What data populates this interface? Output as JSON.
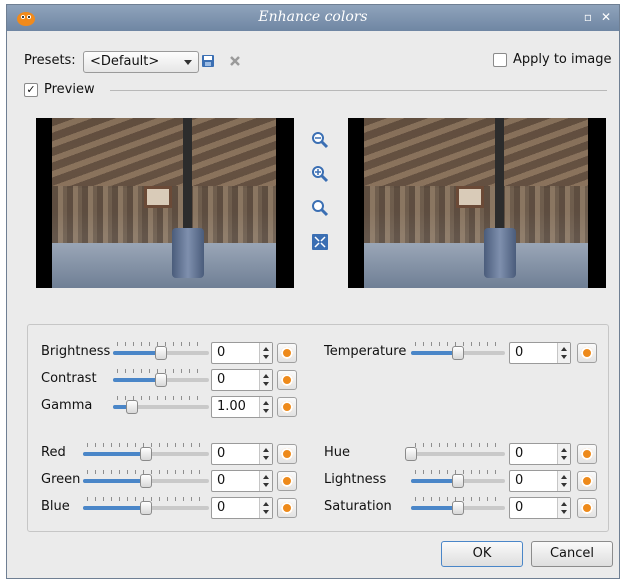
{
  "window": {
    "title": "Enhance colors"
  },
  "presets": {
    "label": "Presets:",
    "selected": "<Default>"
  },
  "apply_to_image": {
    "label": "Apply to image",
    "checked": false
  },
  "preview": {
    "label": "Preview",
    "checked": true,
    "checkmark": "✓"
  },
  "icons": {
    "app": "gimp-wilber-icon",
    "save_preset": "floppy-disk-icon",
    "delete_preset": "delete-icon",
    "zoom_out": "zoom-out-icon",
    "zoom_in": "zoom-in-icon",
    "zoom_fit": "zoom-fit-icon",
    "zoom_full": "fullscreen-icon",
    "reset": "reset-icon"
  },
  "adjustments": {
    "brightness": {
      "label": "Brightness",
      "value": "0",
      "level": 0.5
    },
    "contrast": {
      "label": "Contrast",
      "value": "0",
      "level": 0.5
    },
    "gamma": {
      "label": "Gamma",
      "value": "1.00",
      "level": 0.2
    },
    "temperature": {
      "label": "Temperature",
      "value": "0",
      "level": 0.5
    },
    "red": {
      "label": "Red",
      "value": "0",
      "level": 0.5
    },
    "green": {
      "label": "Green",
      "value": "0",
      "level": 0.5
    },
    "blue": {
      "label": "Blue",
      "value": "0",
      "level": 0.5
    },
    "hue": {
      "label": "Hue",
      "value": "0",
      "level": 0.0
    },
    "lightness": {
      "label": "Lightness",
      "value": "0",
      "level": 0.5
    },
    "saturation": {
      "label": "Saturation",
      "value": "0",
      "level": 0.5
    }
  },
  "buttons": {
    "ok": "OK",
    "cancel": "Cancel"
  },
  "colors": {
    "accent": "#4a86c8",
    "reset_orange": "#ee8a1a"
  }
}
